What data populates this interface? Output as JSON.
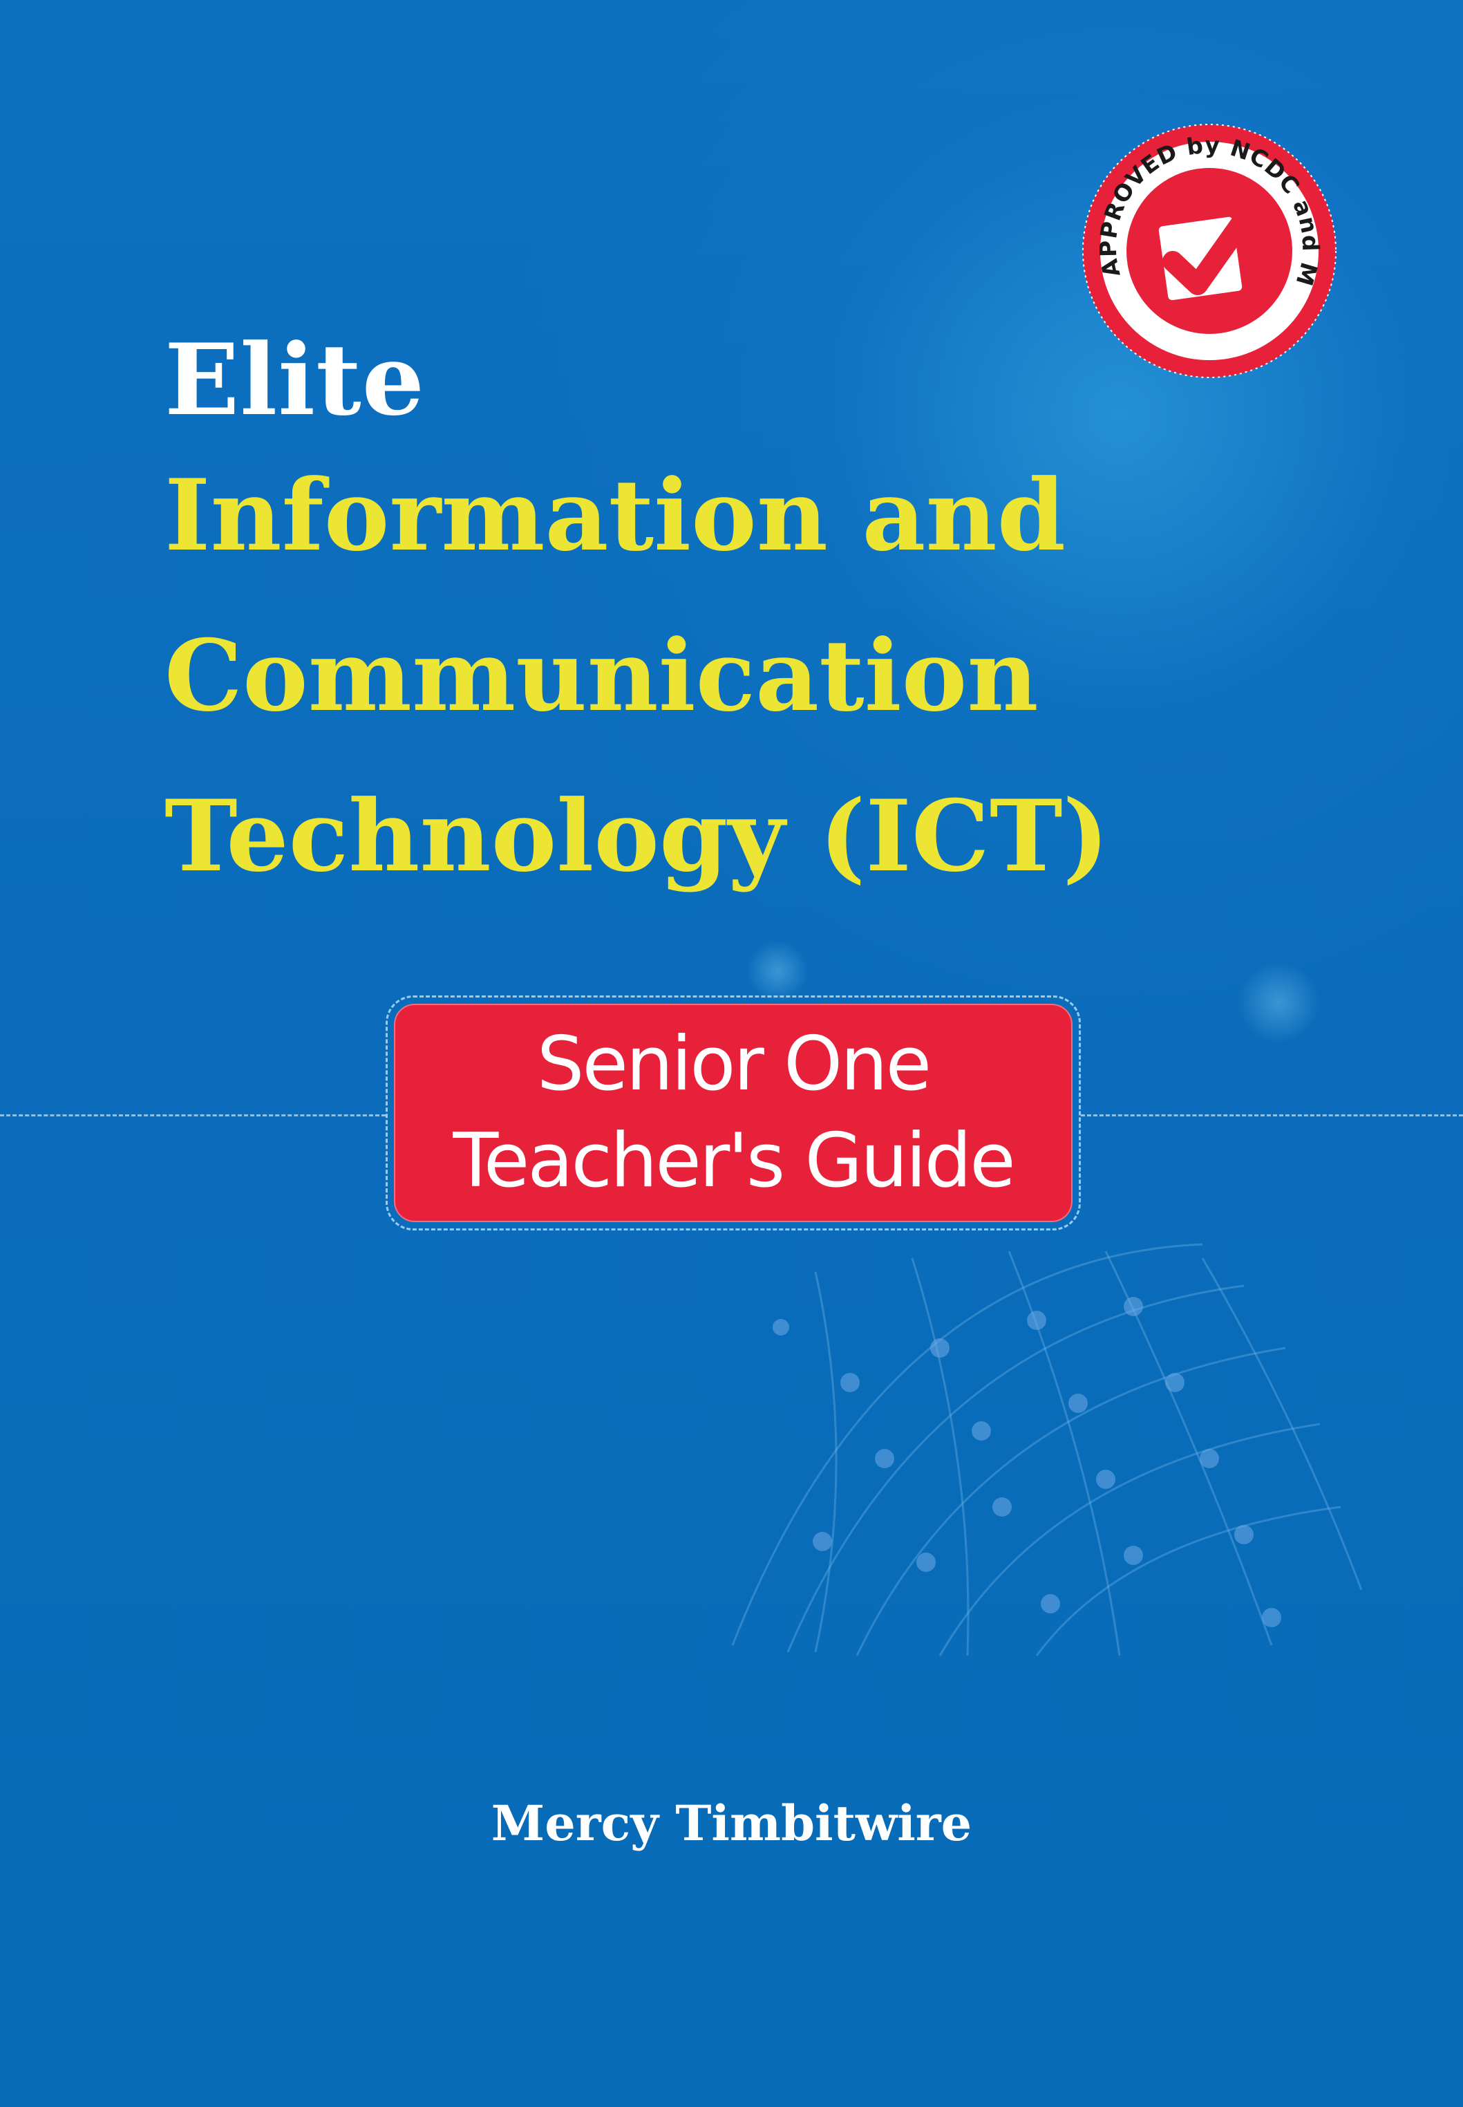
{
  "cover": {
    "series_name": "Elite",
    "title_lines": [
      "Information and",
      "Communication",
      "Technology (ICT)"
    ],
    "badge_lines": [
      "Senior One",
      "Teacher's Guide"
    ],
    "author": "Mercy Timbitwire",
    "stamp_text": "APPROVED by NCDC and MoES"
  },
  "colors": {
    "background": "#0a6dbb",
    "title_yellow": "#ece534",
    "badge_red": "#e8213a",
    "white": "#ffffff"
  }
}
